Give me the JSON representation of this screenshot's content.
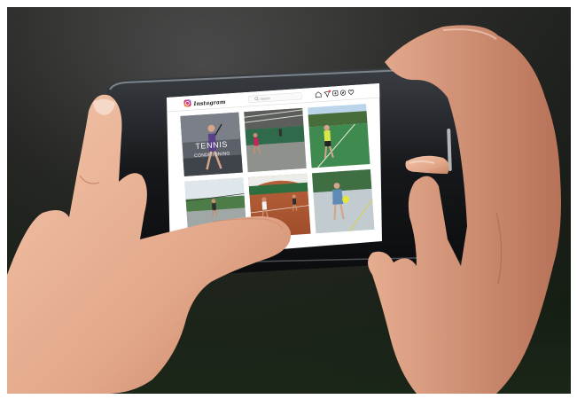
{
  "instagram": {
    "app_name": "Instagram",
    "search_placeholder": "Search",
    "nav_icons": [
      "home-icon",
      "direct-icon",
      "new-post-icon",
      "explore-icon",
      "activity-icon"
    ],
    "grid": {
      "post_1_overlay_line1": "TENNIS",
      "post_1_overlay_line2": "CONDITIONING"
    }
  },
  "colors": {
    "brand_gradient_start": "#f9c33f",
    "brand_gradient_mid": "#e2306c",
    "brand_gradient_end": "#5b51d8",
    "notification_red": "#ed4956"
  }
}
